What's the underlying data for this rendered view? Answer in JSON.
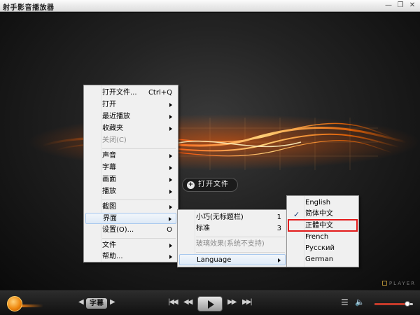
{
  "window": {
    "title": "射手影音播放器",
    "buttons": {
      "minimize": "—",
      "maximize": "❐",
      "close": "✕"
    }
  },
  "video": {
    "open_file_label": "打开文件",
    "brand_mark": "PLAYER"
  },
  "main_menu": {
    "items": [
      {
        "label": "打开文件...",
        "shortcut": "Ctrl+Q",
        "submenu": false
      },
      {
        "label": "打开",
        "submenu": true
      },
      {
        "label": "最近播放",
        "submenu": true
      },
      {
        "label": "收藏夹",
        "submenu": true
      },
      {
        "label": "关闭(C)",
        "submenu": false,
        "disabled": true
      },
      {
        "label": "声音",
        "submenu": true
      },
      {
        "label": "字幕",
        "submenu": true
      },
      {
        "label": "画面",
        "submenu": true
      },
      {
        "label": "播放",
        "submenu": true
      },
      {
        "label": "截图",
        "submenu": true
      },
      {
        "label": "界面",
        "submenu": true,
        "highlighted": true
      },
      {
        "label": "设置(O)...",
        "shortcut": "O"
      },
      {
        "label": "文件",
        "submenu": true
      },
      {
        "label": "帮助...",
        "submenu": true
      }
    ]
  },
  "interface_menu": {
    "items": [
      {
        "label": "小巧(无标题栏)",
        "shortcut": "1"
      },
      {
        "label": "标准",
        "shortcut": "3"
      },
      {
        "label": "玻璃效果(系统不支持)",
        "disabled": true
      },
      {
        "label": "Language",
        "submenu": true,
        "highlighted": true
      }
    ]
  },
  "language_menu": {
    "items": [
      {
        "label": "English"
      },
      {
        "label": "简体中文",
        "checked": true
      },
      {
        "label": "正體中文",
        "outlined": true
      },
      {
        "label": "French"
      },
      {
        "label": "Русский"
      },
      {
        "label": "German"
      }
    ]
  },
  "controls": {
    "subtitle_label": "字幕",
    "volume_level": 0.85,
    "colors": {
      "accent": "#f08a10",
      "volume_fill": "#c63a2a",
      "highlight_box": "#e31b1b"
    }
  }
}
